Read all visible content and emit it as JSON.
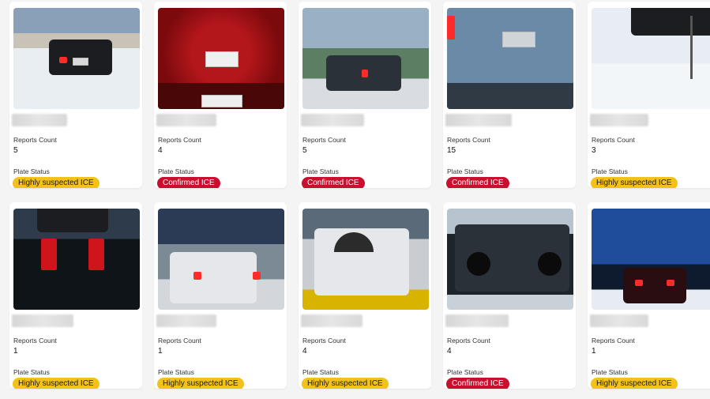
{
  "fields": {
    "reports_count_label": "Reports Count",
    "plate_status_label": "Plate Status"
  },
  "cards": [
    {
      "count": "5",
      "status": "Highly suspected ICE",
      "status_color": "#f2c21b"
    },
    {
      "count": "4",
      "status": "Confirmed ICE",
      "status_color": "#c8102e"
    },
    {
      "count": "5",
      "status": "Confirmed ICE",
      "status_color": "#c8102e"
    },
    {
      "count": "15",
      "status": "Confirmed ICE",
      "status_color": "#c8102e"
    },
    {
      "count": "3",
      "status": "Highly suspected ICE",
      "status_color": "#f2c21b"
    },
    {
      "count": "1",
      "status": "Highly suspected ICE",
      "status_color": "#f2c21b"
    },
    {
      "count": "1",
      "status": "Highly suspected ICE",
      "status_color": "#f2c21b"
    },
    {
      "count": "4",
      "status": "Highly suspected ICE",
      "status_color": "#f2c21b"
    },
    {
      "count": "4",
      "status": "Confirmed ICE",
      "status_color": "#c8102e"
    },
    {
      "count": "1",
      "status": "Highly suspected ICE",
      "status_color": "#f2c21b"
    }
  ]
}
